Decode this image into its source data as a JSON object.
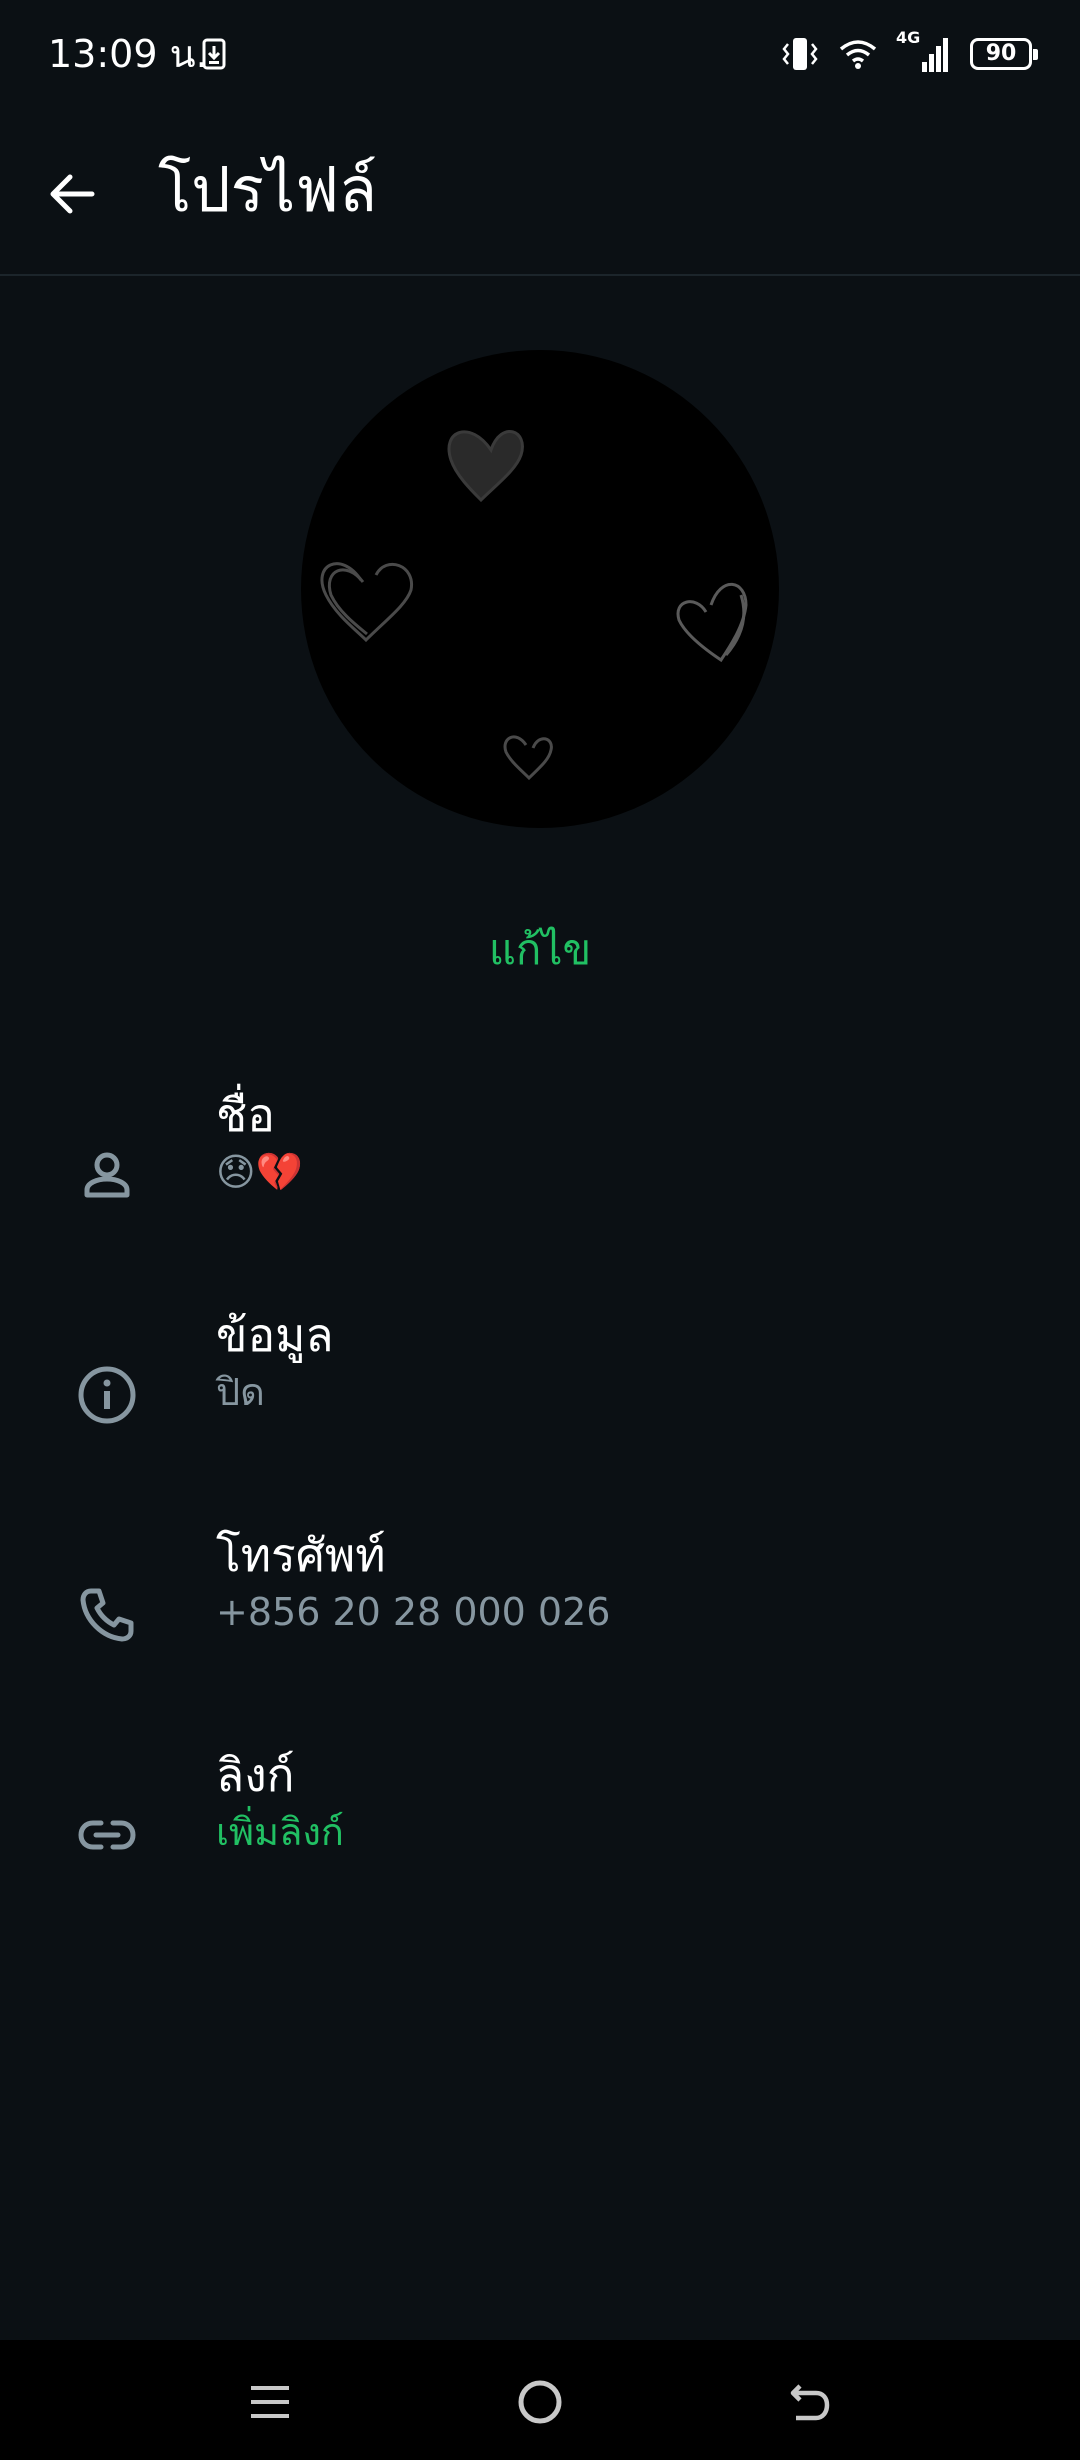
{
  "status_bar": {
    "time": "13:09 น.",
    "battery_level": "90",
    "network_type": "4G"
  },
  "app_bar": {
    "title": "โปรไฟล์"
  },
  "profile": {
    "edit_label": "แก้ไข"
  },
  "rows": {
    "name": {
      "label": "ชื่อ",
      "value": "😞💔",
      "icon": "person-icon"
    },
    "about": {
      "label": "ข้อมูล",
      "value": "ปิด",
      "icon": "info-icon"
    },
    "phone": {
      "label": "โทรศัพท์",
      "value": "+856 20 28 000 026",
      "icon": "phone-icon"
    },
    "links": {
      "label": "ลิงก์",
      "value": "เพิ่มลิงก์",
      "icon": "link-icon"
    }
  },
  "colors": {
    "background": "#0b1014",
    "accent": "#21c063",
    "secondary_text": "#8696a0",
    "icon": "#8696a0"
  },
  "nav_bar": {
    "buttons": [
      "menu-icon",
      "home-icon",
      "back-icon"
    ]
  }
}
